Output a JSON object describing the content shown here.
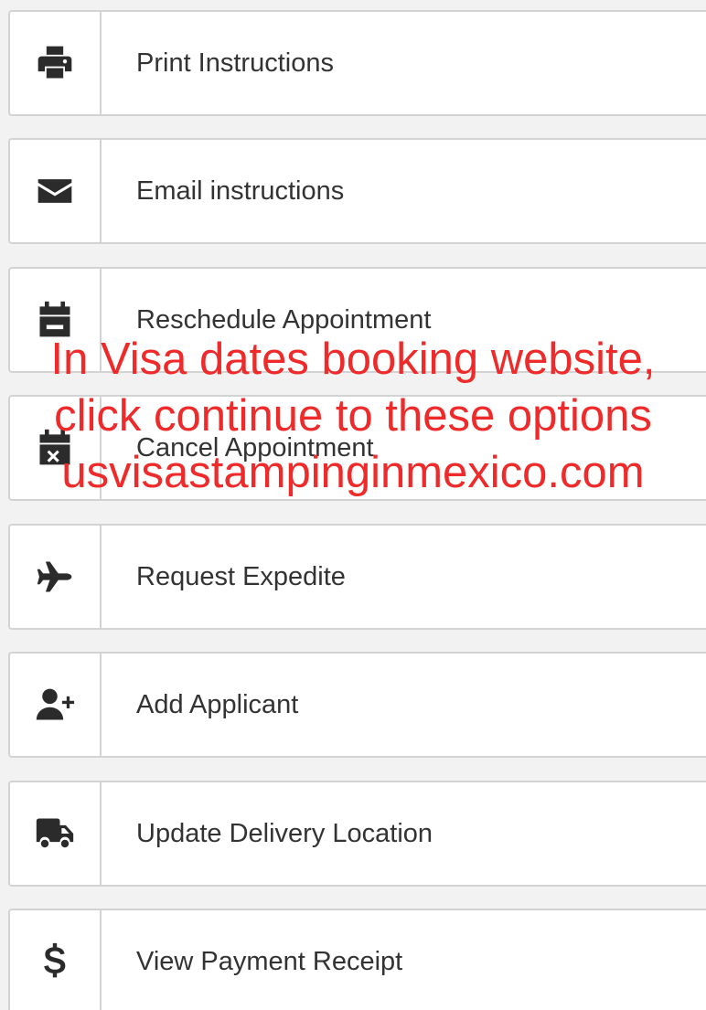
{
  "options": [
    {
      "label": "Print Instructions",
      "icon": "print-icon"
    },
    {
      "label": "Email instructions",
      "icon": "envelope-icon"
    },
    {
      "label": "Reschedule Appointment",
      "icon": "calendar-minus-icon"
    },
    {
      "label": "Cancel Appointment",
      "icon": "calendar-times-icon"
    },
    {
      "label": "Request Expedite",
      "icon": "plane-icon"
    },
    {
      "label": "Add Applicant",
      "icon": "user-plus-icon"
    },
    {
      "label": "Update Delivery Location",
      "icon": "truck-icon"
    },
    {
      "label": "View Payment Receipt",
      "icon": "dollar-icon"
    }
  ],
  "overlay": {
    "line1": "In Visa dates booking website,",
    "line2": "click continue to these options",
    "line3": "usvisastampinginmexico.com",
    "color": "#ee2a2a"
  }
}
